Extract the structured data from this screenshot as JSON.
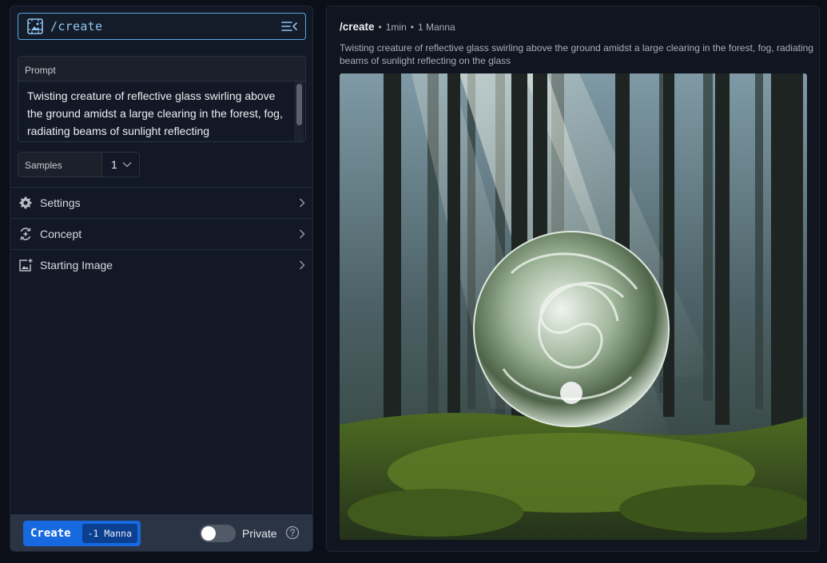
{
  "command_bar": {
    "command": "/create",
    "icon": "image-frame-icon",
    "menu_icon": "collapse-menu-icon"
  },
  "prompt": {
    "label": "Prompt",
    "text": "Twisting creature of reflective glass  swirling above the ground amidst a large clearing in the forest, fog, radiating beams of sunlight reflecting"
  },
  "samples": {
    "label": "Samples",
    "value": "1"
  },
  "sections": [
    {
      "label": "Settings",
      "icon": "gear-icon"
    },
    {
      "label": "Concept",
      "icon": "concept-icon"
    },
    {
      "label": "Starting Image",
      "icon": "add-image-icon"
    }
  ],
  "footer": {
    "create_label": "Create",
    "cost_label": "-1 Manna",
    "private_label": "Private",
    "private_enabled": false
  },
  "result": {
    "command": "/create",
    "age": "1min",
    "cost": "1 Manna",
    "description": "Twisting creature of reflective glass swirling above the ground amidst a large clearing in the forest, fog, radiating beams of sunlight reflecting on the glass"
  },
  "colors": {
    "accent": "#1769e0",
    "focus_border": "#5aa9e6",
    "panel": "#121826"
  }
}
